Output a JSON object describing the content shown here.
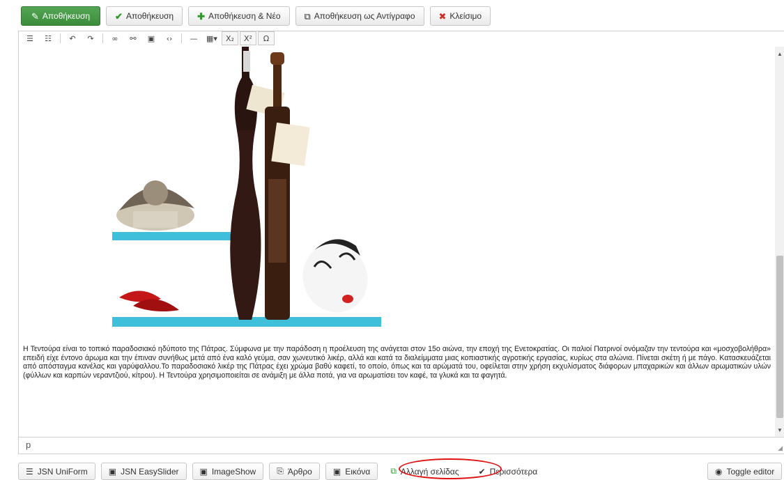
{
  "toolbar": {
    "save": "Αποθήκευση",
    "apply": "Αποθήκευση",
    "save_new": "Αποθήκευση & Νέο",
    "save_copy": "Αποθήκευση ως Αντίγραφο",
    "close": "Κλείσιμο"
  },
  "editor_toolbar": {
    "buttons": [
      "bullet-list-icon",
      "numbered-list-icon",
      "undo-icon",
      "redo-icon",
      "link-icon",
      "unlink-icon",
      "image-icon",
      "code-icon",
      "horizontal-rule-icon",
      "table-icon",
      "subscript-icon",
      "superscript-icon",
      "special-character-icon"
    ]
  },
  "content": {
    "paragraph": "Η Τεντούρα είναι το τοπικό παραδοσιακό ηδύποτο της Πάτρας. Σύμφωνα με την παράδοση η προέλευση της ανάγεται στον 15ο αιώνα, την εποχή της Ενετοκρατίας. Οι παλιοί Πατρινοί ονόμαζαν την τεντούρα και «μοσχοβολήθρα» επειδή είχε έντονο άρωμα και την έπιναν συνήθως μετά από ένα καλό γεύμα, σαν χωνευτικό λικέρ, αλλά και κατά τα διαλείμματα μιας κοπιαστικής αγροτικής εργασίας, κυρίως στα αλώνια. Πίνεται σκέτη ή με πάγο. Κατασκευάζεται από απόσταγμα κανέλας και γαρύφαλλου.Το παραδοσιακό λικέρ της Πάτρας έχει χρώμα βαθύ καφετί, το οποίο, όπως και τα αρώματά του, οφείλεται στην χρήση εκχυλίσματος διάφορων μπαχαρικών και άλλων αρωματικών υλών (φύλλων και καρπών νεραντζιού, κίτρου). Η Τεντούρα χρησιμοποιείται σε ανάμιξη με άλλα ποτά, για να αρωματίσει τον καφέ, τα γλυκά και τα φαγητά."
  },
  "statusbar": {
    "path": "p"
  },
  "bottom_buttons": {
    "uniform": "JSN UniForm",
    "easyslider": "JSN EasySlider",
    "imageshow": "ImageShow",
    "article": "Άρθρο",
    "image": "Εικόνα",
    "pagebreak": "Αλλαγή σελίδας",
    "more": "Περισσότερα",
    "toggle": "Toggle editor"
  },
  "colors": {
    "primary_green": "#46a046",
    "highlight_red": "#e01010",
    "shelf_blue": "#3fbfd9"
  }
}
